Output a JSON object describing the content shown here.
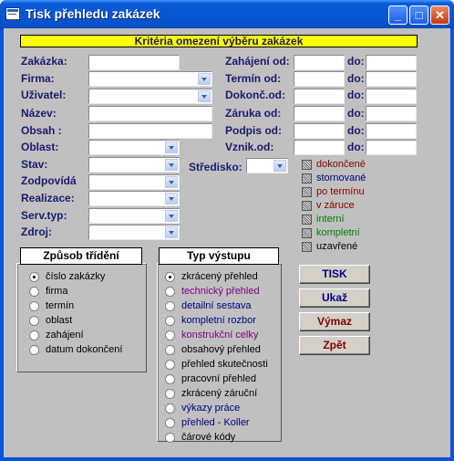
{
  "window": {
    "title": "Tisk přehledu zakázek",
    "minimize": "_",
    "maximize": "□",
    "close": "✕"
  },
  "banner": "Kritéria omezení výběru zakázek",
  "left_labels": [
    "Zakázka:",
    "Firma:",
    "Uživatel:",
    "Název:",
    "Obsah :",
    "Oblast:",
    "Stav:",
    "Zodpovídá",
    "Realizace:",
    "Serv.typ:",
    "Zdroj:"
  ],
  "date_labels": [
    "Zahájení od:",
    "Termín od:",
    "Dokonč.od:",
    "Záruka od:",
    "Podpis od:",
    "Vznik.od:"
  ],
  "do_label": "do:",
  "stredisko_label": "Středisko:",
  "status_checks": [
    {
      "label": "dokončené",
      "color": "#800000"
    },
    {
      "label": "stornované",
      "color": "#000080"
    },
    {
      "label": "po termínu",
      "color": "#800000"
    },
    {
      "label": "v záruce",
      "color": "#800000"
    },
    {
      "label": "interní",
      "color": "#008000"
    },
    {
      "label": "kompletní",
      "color": "#008000"
    },
    {
      "label": "uzavřené",
      "color": "#000000"
    }
  ],
  "sort": {
    "title": "Způsob třídění",
    "selected": 0,
    "options": [
      "číslo zakázky",
      "firma",
      "termín",
      "oblast",
      "zahájení",
      "datum dokončení"
    ]
  },
  "output": {
    "title": "Typ výstupu",
    "selected": 0,
    "options": [
      {
        "label": "zkrácený přehled",
        "color": "#000000"
      },
      {
        "label": "technický přehled",
        "color": "#800080"
      },
      {
        "label": "detailní sestava",
        "color": "#000080"
      },
      {
        "label": "kompletní rozbor",
        "color": "#000080"
      },
      {
        "label": "konstrukční celky",
        "color": "#800080"
      },
      {
        "label": "obsahový přehled",
        "color": "#000000"
      },
      {
        "label": "přehled skutečnosti",
        "color": "#000000"
      },
      {
        "label": "pracovní přehled",
        "color": "#000000"
      },
      {
        "label": "zkrácený záruční",
        "color": "#000000"
      },
      {
        "label": "výkazy práce",
        "color": "#000080"
      },
      {
        "label": "přehled - Koller",
        "color": "#000080"
      },
      {
        "label": "čárové kódy",
        "color": "#000000"
      }
    ]
  },
  "buttons": [
    {
      "label": "TISK",
      "color": "#000080"
    },
    {
      "label": "Ukaž",
      "color": "#000080"
    },
    {
      "label": "Výmaz",
      "color": "#800000"
    },
    {
      "label": "Zpět",
      "color": "#800000"
    }
  ]
}
